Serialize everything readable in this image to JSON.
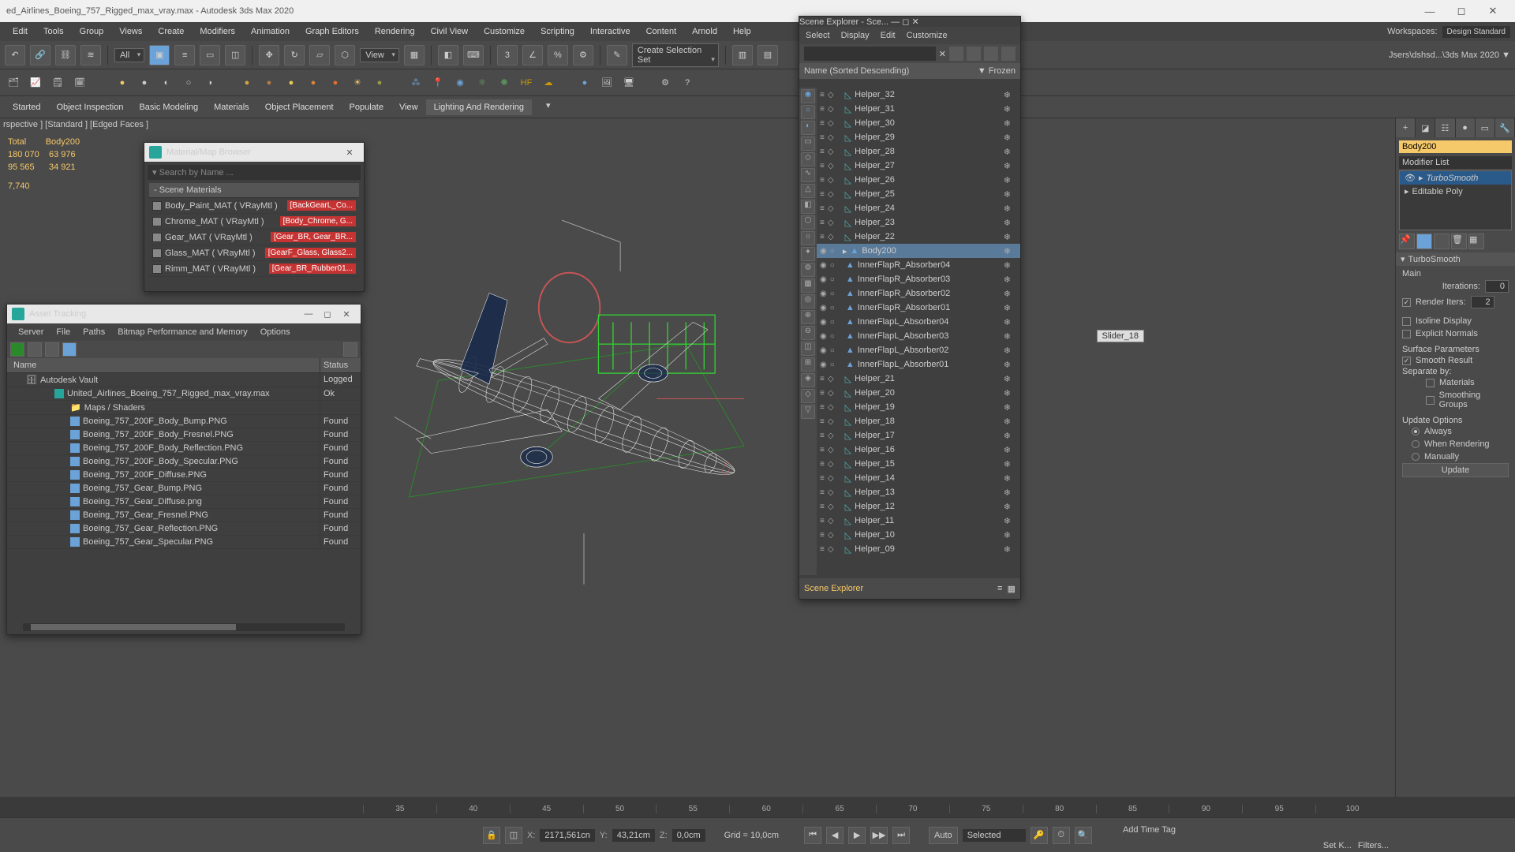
{
  "window": {
    "title": "ed_Airlines_Boeing_757_Rigged_max_vray.max - Autodesk 3ds Max 2020",
    "workspace_label": "Workspaces:",
    "workspace_value": "Design Standard",
    "path_hint": "Jsers\\dshsd...\\3ds Max 2020 ▼"
  },
  "menu": [
    "Edit",
    "Tools",
    "Group",
    "Views",
    "Create",
    "Modifiers",
    "Animation",
    "Graph Editors",
    "Rendering",
    "Civil View",
    "Customize",
    "Scripting",
    "Interactive",
    "Content",
    "Arnold",
    "Help"
  ],
  "main_toolbar": {
    "filter": "All",
    "view": "View",
    "sel_set": "Create Selection Set"
  },
  "ribbon": {
    "tabs": [
      "Started",
      "Object Inspection",
      "Basic Modeling",
      "Materials",
      "Object Placement",
      "Populate",
      "View",
      "Lighting And Rendering"
    ],
    "active": 7
  },
  "viewport": {
    "label": "rspective ] [Standard ] [Edged Faces ]",
    "stats": {
      "total_label": "Total",
      "sel_label": "Body200",
      "r1a": "180 070",
      "r1b": "63 976",
      "r2a": "95 565",
      "r2b": "34 921",
      "r3a": "7,740"
    },
    "slider_label": "Slider_18"
  },
  "material_browser": {
    "title": "Material/Map Browser",
    "search": "Search by Name ...",
    "group": "-  Scene Materials",
    "items": [
      {
        "name": "Body_Paint_MAT  ( VRayMtl )",
        "tag": "[BackGearL_Co..."
      },
      {
        "name": "Chrome_MAT  ( VRayMtl )",
        "tag": "[Body_Chrome, G..."
      },
      {
        "name": "Gear_MAT  ( VRayMtl )",
        "tag": "[Gear_BR, Gear_BR..."
      },
      {
        "name": "Glass_MAT  ( VRayMtl )",
        "tag": "[GearF_Glass, Glass2..."
      },
      {
        "name": "Rimm_MAT  ( VRayMtl )",
        "tag": "[Gear_BR_Rubber01..."
      }
    ]
  },
  "asset_tracking": {
    "title": "Asset Tracking",
    "menu": [
      "Server",
      "File",
      "Paths",
      "Bitmap Performance and Memory",
      "Options"
    ],
    "cols": {
      "name": "Name",
      "status": "Status"
    },
    "rows": [
      {
        "indent": 1,
        "icon": "vault",
        "name": "Autodesk Vault",
        "status": "Logged"
      },
      {
        "indent": 2,
        "icon": "max",
        "name": "United_Airlines_Boeing_757_Rigged_max_vray.max",
        "status": "Ok"
      },
      {
        "indent": 3,
        "icon": "folder",
        "name": "Maps / Shaders",
        "status": ""
      },
      {
        "indent": 3,
        "icon": "img",
        "name": "Boeing_757_200F_Body_Bump.PNG",
        "status": "Found"
      },
      {
        "indent": 3,
        "icon": "img",
        "name": "Boeing_757_200F_Body_Fresnel.PNG",
        "status": "Found"
      },
      {
        "indent": 3,
        "icon": "img",
        "name": "Boeing_757_200F_Body_Reflection.PNG",
        "status": "Found"
      },
      {
        "indent": 3,
        "icon": "img",
        "name": "Boeing_757_200F_Body_Specular.PNG",
        "status": "Found"
      },
      {
        "indent": 3,
        "icon": "img",
        "name": "Boeing_757_200F_Diffuse.PNG",
        "status": "Found"
      },
      {
        "indent": 3,
        "icon": "img",
        "name": "Boeing_757_Gear_Bump.PNG",
        "status": "Found"
      },
      {
        "indent": 3,
        "icon": "img",
        "name": "Boeing_757_Gear_Diffuse.png",
        "status": "Found"
      },
      {
        "indent": 3,
        "icon": "img",
        "name": "Boeing_757_Gear_Fresnel.PNG",
        "status": "Found"
      },
      {
        "indent": 3,
        "icon": "img",
        "name": "Boeing_757_Gear_Reflection.PNG",
        "status": "Found"
      },
      {
        "indent": 3,
        "icon": "img",
        "name": "Boeing_757_Gear_Specular.PNG",
        "status": "Found"
      }
    ]
  },
  "scene_explorer": {
    "title": "Scene Explorer - Sce...",
    "menu": [
      "Select",
      "Display",
      "Edit",
      "Customize"
    ],
    "header": {
      "name": "Name (Sorted Descending)",
      "frozen": "▼ Frozen"
    },
    "footer": "Scene Explorer",
    "rows": [
      {
        "name": "Helper_32",
        "type": "helper"
      },
      {
        "name": "Helper_31",
        "type": "helper"
      },
      {
        "name": "Helper_30",
        "type": "helper"
      },
      {
        "name": "Helper_29",
        "type": "helper"
      },
      {
        "name": "Helper_28",
        "type": "helper"
      },
      {
        "name": "Helper_27",
        "type": "helper"
      },
      {
        "name": "Helper_26",
        "type": "helper"
      },
      {
        "name": "Helper_25",
        "type": "helper"
      },
      {
        "name": "Helper_24",
        "type": "helper"
      },
      {
        "name": "Helper_23",
        "type": "helper"
      },
      {
        "name": "Helper_22",
        "type": "helper"
      },
      {
        "name": "Body200",
        "type": "geom",
        "sel": true
      },
      {
        "name": "InnerFlapR_Absorber04",
        "type": "geom"
      },
      {
        "name": "InnerFlapR_Absorber03",
        "type": "geom"
      },
      {
        "name": "InnerFlapR_Absorber02",
        "type": "geom"
      },
      {
        "name": "InnerFlapR_Absorber01",
        "type": "geom"
      },
      {
        "name": "InnerFlapL_Absorber04",
        "type": "geom"
      },
      {
        "name": "InnerFlapL_Absorber03",
        "type": "geom"
      },
      {
        "name": "InnerFlapL_Absorber02",
        "type": "geom"
      },
      {
        "name": "InnerFlapL_Absorber01",
        "type": "geom"
      },
      {
        "name": "Helper_21",
        "type": "helper"
      },
      {
        "name": "Helper_20",
        "type": "helper"
      },
      {
        "name": "Helper_19",
        "type": "helper"
      },
      {
        "name": "Helper_18",
        "type": "helper"
      },
      {
        "name": "Helper_17",
        "type": "helper"
      },
      {
        "name": "Helper_16",
        "type": "helper"
      },
      {
        "name": "Helper_15",
        "type": "helper"
      },
      {
        "name": "Helper_14",
        "type": "helper"
      },
      {
        "name": "Helper_13",
        "type": "helper"
      },
      {
        "name": "Helper_12",
        "type": "helper"
      },
      {
        "name": "Helper_11",
        "type": "helper"
      },
      {
        "name": "Helper_10",
        "type": "helper"
      },
      {
        "name": "Helper_09",
        "type": "helper"
      }
    ]
  },
  "command_panel": {
    "object_name": "Body200",
    "modifier_list": "Modifier List",
    "stack": [
      {
        "name": "TurboSmooth",
        "sel": true,
        "italic": true
      },
      {
        "name": "Editable Poly"
      }
    ],
    "rollout_title": "TurboSmooth",
    "main_label": "Main",
    "iterations_label": "Iterations:",
    "iterations_value": "0",
    "render_iters_label": "Render Iters:",
    "render_iters_value": "2",
    "render_iters_checked": true,
    "isoline": "Isoline Display",
    "explicit": "Explicit Normals",
    "surface_params": "Surface Parameters",
    "smooth_result": "Smooth Result",
    "smooth_checked": true,
    "separate_by": "Separate by:",
    "sep_materials": "Materials",
    "sep_smoothing": "Smoothing Groups",
    "update_options": "Update Options",
    "upd_always": "Always",
    "upd_render": "When Rendering",
    "upd_manual": "Manually",
    "update_btn": "Update"
  },
  "timeline_ticks": [
    "35",
    "40",
    "45",
    "50",
    "55",
    "60",
    "65",
    "70",
    "75",
    "80",
    "85",
    "90",
    "95",
    "100"
  ],
  "status": {
    "x_label": "X:",
    "x": "2171,561cn",
    "y_label": "Y:",
    "y": "43,21cm",
    "z_label": "Z:",
    "z": "0,0cm",
    "grid": "Grid = 10,0cm",
    "auto": "Auto",
    "selected": "Selected",
    "addtime": "Add Time Tag",
    "setk": "Set K...",
    "filters": "Filters..."
  }
}
